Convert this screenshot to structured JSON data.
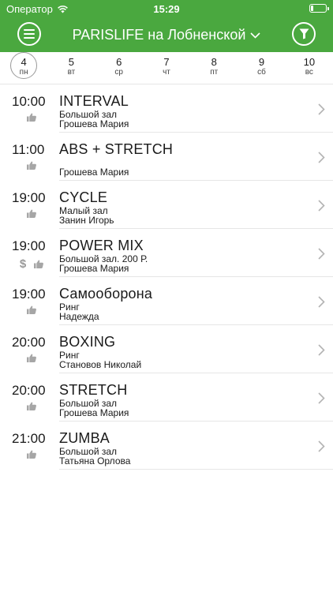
{
  "status": {
    "carrier": "Оператор",
    "time": "15:29"
  },
  "header": {
    "title": "PARISLIFE на Лобненской"
  },
  "days": [
    {
      "num": "4",
      "dow": "пн",
      "selected": true
    },
    {
      "num": "5",
      "dow": "вт"
    },
    {
      "num": "6",
      "dow": "ср"
    },
    {
      "num": "7",
      "dow": "чт"
    },
    {
      "num": "8",
      "dow": "пт"
    },
    {
      "num": "9",
      "dow": "сб"
    },
    {
      "num": "10",
      "dow": "вс"
    }
  ],
  "classes": [
    {
      "time": "10:00",
      "title": "INTERVAL",
      "room": "Большой зал",
      "trainer": "Грошева Мария",
      "paid": false
    },
    {
      "time": "11:00",
      "title": "ABS + STRETCH",
      "room": "",
      "trainer": "Грошева Мария",
      "paid": false
    },
    {
      "time": "19:00",
      "title": "CYCLE",
      "room": "Малый зал",
      "trainer": "Занин Игорь",
      "paid": false
    },
    {
      "time": "19:00",
      "title": "POWER MIX",
      "room": "Большой зал. 200 Р.",
      "trainer": "Грошева Мария",
      "paid": true
    },
    {
      "time": "19:00",
      "title": "Самооборона",
      "room": "Ринг",
      "trainer": "Надежда",
      "paid": false
    },
    {
      "time": "20:00",
      "title": "BOXING",
      "room": "Ринг",
      "trainer": "Становов Николай",
      "paid": false
    },
    {
      "time": "20:00",
      "title": "STRETCH",
      "room": "Большой зал",
      "trainer": "Грошева Мария",
      "paid": false
    },
    {
      "time": "21:00",
      "title": "ZUMBA",
      "room": "Большой зал",
      "trainer": "Татьяна Орлова",
      "paid": false
    }
  ],
  "icons": {
    "menu": "menu-icon",
    "filter": "filter-icon",
    "like": "thumbs-up-icon",
    "price": "dollar-icon",
    "chevron": "chevron-right-icon"
  },
  "colors": {
    "brand": "#4aa83f"
  }
}
